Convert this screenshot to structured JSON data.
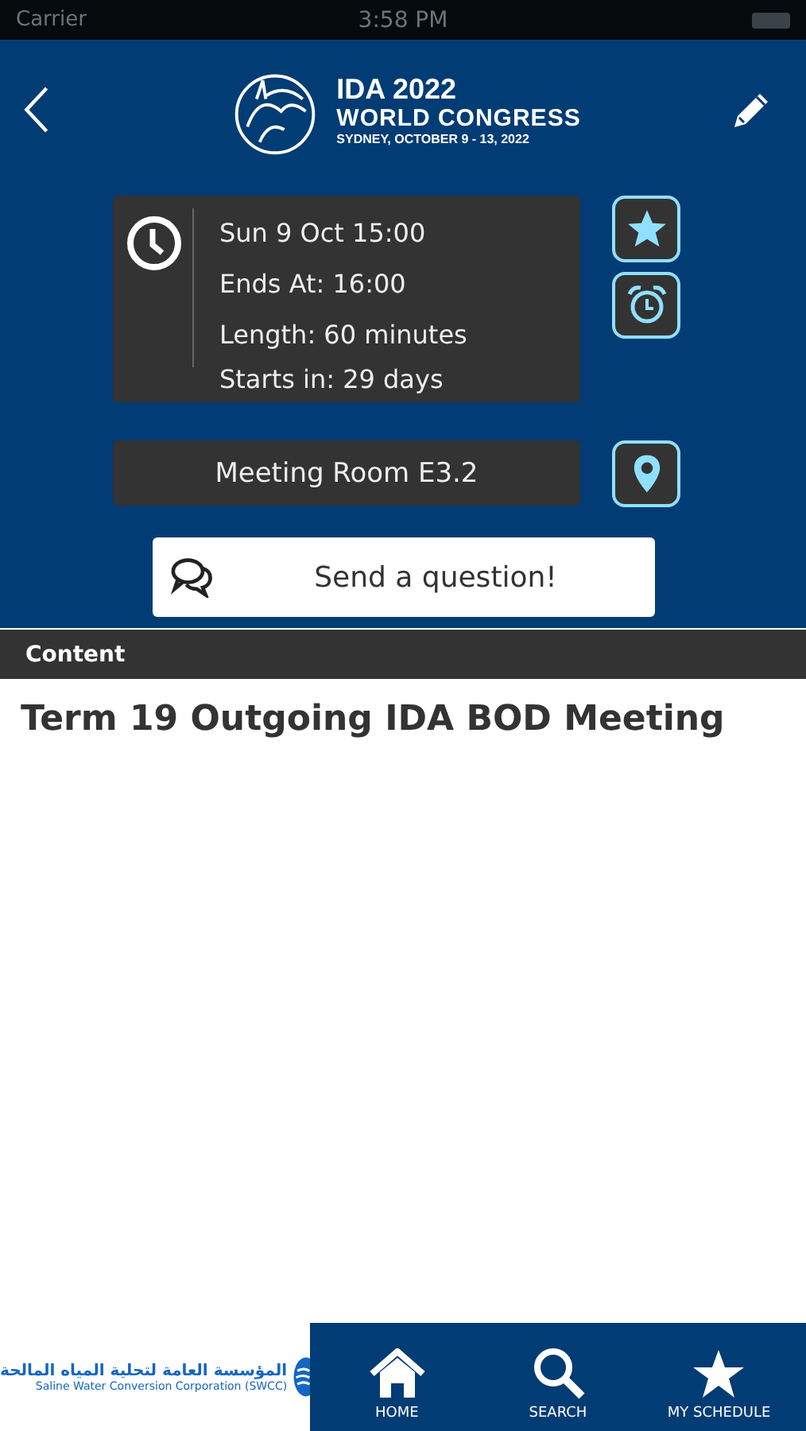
{
  "status_bar": {
    "carrier": "Carrier",
    "time": "3:58 PM"
  },
  "header": {
    "logo": {
      "line_1": "IDA 2022",
      "line_2": "WORLD CONGRESS",
      "line_3": "SYDNEY, OCTOBER 9 - 13, 2022"
    }
  },
  "session": {
    "times": [
      "Sun 9  Oct  15:00",
      "Ends At: 16:00",
      "Length: 60 minutes",
      "Starts in: 29 days"
    ],
    "starred": true,
    "room": "Meeting Room E3.2",
    "question_button": "Send a question!"
  },
  "content": {
    "heading": "Content",
    "title": "Term 19 Outgoing IDA BOD Meeting"
  },
  "sponsor": {
    "arabic": "المؤسسة العامة لتحلية المياه المالحة",
    "english": "Saline Water Conversion Corporation (SWCC)"
  },
  "tab_bar": [
    {
      "kind": "home",
      "label": "HOME"
    },
    {
      "kind": "search",
      "label": "SEARCH"
    },
    {
      "kind": "star",
      "label": "MY SCHEDULE"
    }
  ]
}
